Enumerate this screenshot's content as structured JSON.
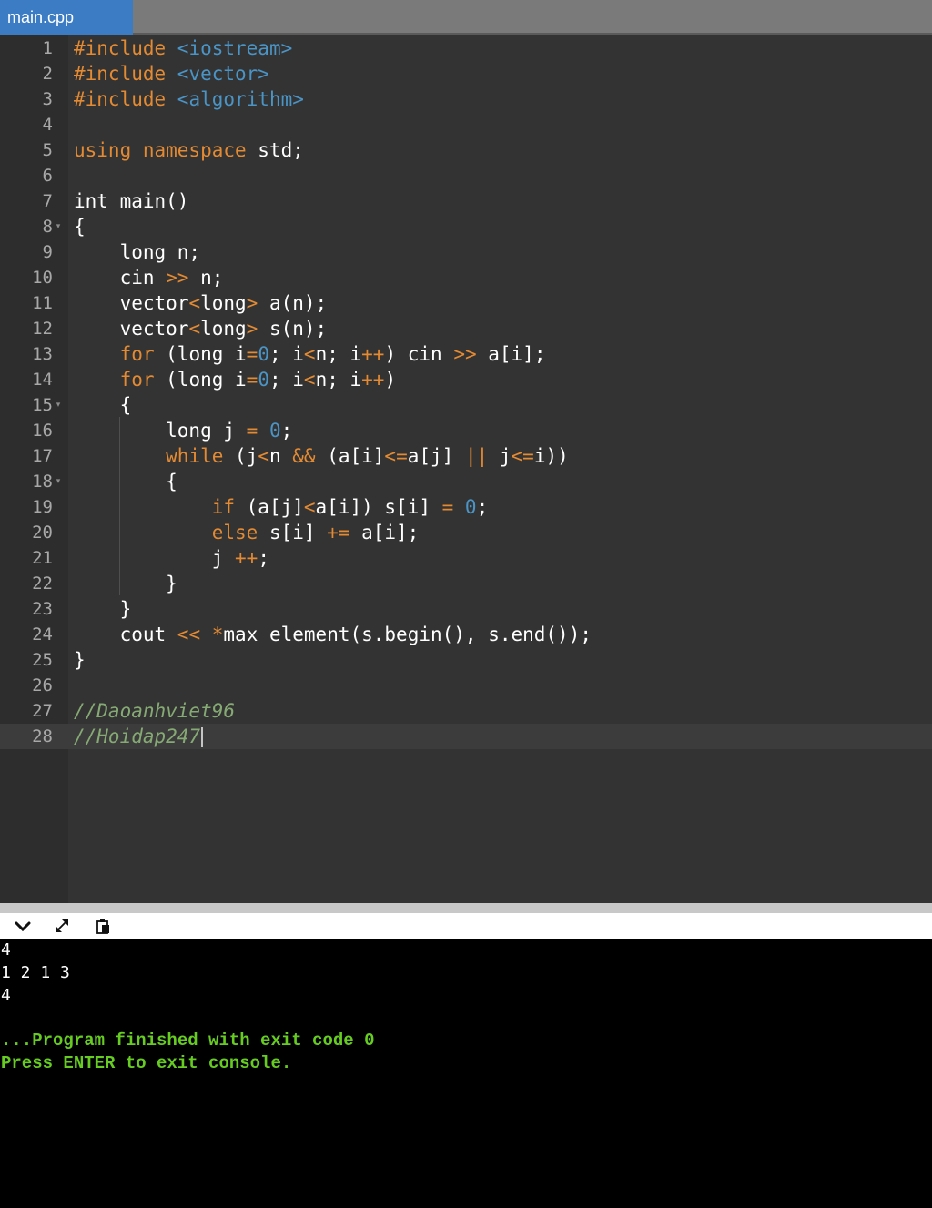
{
  "tab": {
    "label": "main.cpp"
  },
  "editor": {
    "lines": [
      {
        "num": "1",
        "tokens": [
          [
            "pre",
            "#include "
          ],
          [
            "inc",
            "<iostream>"
          ]
        ]
      },
      {
        "num": "2",
        "tokens": [
          [
            "pre",
            "#include "
          ],
          [
            "inc",
            "<vector>"
          ]
        ]
      },
      {
        "num": "3",
        "tokens": [
          [
            "pre",
            "#include "
          ],
          [
            "inc",
            "<algorithm>"
          ]
        ]
      },
      {
        "num": "4",
        "tokens": []
      },
      {
        "num": "5",
        "tokens": [
          [
            "kw",
            "using namespace"
          ],
          [
            "plain",
            " std;"
          ]
        ]
      },
      {
        "num": "6",
        "tokens": []
      },
      {
        "num": "7",
        "tokens": [
          [
            "plain",
            "int main()"
          ]
        ]
      },
      {
        "num": "8",
        "fold": true,
        "tokens": [
          [
            "plain",
            "{"
          ]
        ]
      },
      {
        "num": "9",
        "tokens": [
          [
            "plain",
            "    long n;"
          ]
        ]
      },
      {
        "num": "10",
        "tokens": [
          [
            "plain",
            "    cin "
          ],
          [
            "op",
            ">>"
          ],
          [
            "plain",
            " n;"
          ]
        ]
      },
      {
        "num": "11",
        "tokens": [
          [
            "plain",
            "    vector"
          ],
          [
            "op",
            "<"
          ],
          [
            "plain",
            "long"
          ],
          [
            "op",
            ">"
          ],
          [
            "plain",
            " a(n);"
          ]
        ]
      },
      {
        "num": "12",
        "tokens": [
          [
            "plain",
            "    vector"
          ],
          [
            "op",
            "<"
          ],
          [
            "plain",
            "long"
          ],
          [
            "op",
            ">"
          ],
          [
            "plain",
            " s(n);"
          ]
        ]
      },
      {
        "num": "13",
        "tokens": [
          [
            "plain",
            "    "
          ],
          [
            "kw",
            "for"
          ],
          [
            "plain",
            " (long i"
          ],
          [
            "op",
            "="
          ],
          [
            "num",
            "0"
          ],
          [
            "plain",
            "; i"
          ],
          [
            "op",
            "<"
          ],
          [
            "plain",
            "n; i"
          ],
          [
            "op",
            "++"
          ],
          [
            "plain",
            ") cin "
          ],
          [
            "op",
            ">>"
          ],
          [
            "plain",
            " a[i];"
          ]
        ]
      },
      {
        "num": "14",
        "tokens": [
          [
            "plain",
            "    "
          ],
          [
            "kw",
            "for"
          ],
          [
            "plain",
            " (long i"
          ],
          [
            "op",
            "="
          ],
          [
            "num",
            "0"
          ],
          [
            "plain",
            "; i"
          ],
          [
            "op",
            "<"
          ],
          [
            "plain",
            "n; i"
          ],
          [
            "op",
            "++"
          ],
          [
            "plain",
            ")"
          ]
        ]
      },
      {
        "num": "15",
        "fold": true,
        "tokens": [
          [
            "plain",
            "    {"
          ]
        ]
      },
      {
        "num": "16",
        "tokens": [
          [
            "plain",
            "        long j "
          ],
          [
            "op",
            "="
          ],
          [
            "plain",
            " "
          ],
          [
            "num",
            "0"
          ],
          [
            "plain",
            ";"
          ]
        ]
      },
      {
        "num": "17",
        "tokens": [
          [
            "plain",
            "        "
          ],
          [
            "kw",
            "while"
          ],
          [
            "plain",
            " (j"
          ],
          [
            "op",
            "<"
          ],
          [
            "plain",
            "n "
          ],
          [
            "op",
            "&&"
          ],
          [
            "plain",
            " (a[i]"
          ],
          [
            "op",
            "<="
          ],
          [
            "plain",
            "a[j] "
          ],
          [
            "op",
            "||"
          ],
          [
            "plain",
            " j"
          ],
          [
            "op",
            "<="
          ],
          [
            "plain",
            "i))"
          ]
        ]
      },
      {
        "num": "18",
        "fold": true,
        "tokens": [
          [
            "plain",
            "        {"
          ]
        ]
      },
      {
        "num": "19",
        "tokens": [
          [
            "plain",
            "            "
          ],
          [
            "kw",
            "if"
          ],
          [
            "plain",
            " (a[j]"
          ],
          [
            "op",
            "<"
          ],
          [
            "plain",
            "a[i]) s[i] "
          ],
          [
            "op",
            "="
          ],
          [
            "plain",
            " "
          ],
          [
            "num",
            "0"
          ],
          [
            "plain",
            ";"
          ]
        ]
      },
      {
        "num": "20",
        "tokens": [
          [
            "plain",
            "            "
          ],
          [
            "kw",
            "else"
          ],
          [
            "plain",
            " s[i] "
          ],
          [
            "op",
            "+="
          ],
          [
            "plain",
            " a[i];"
          ]
        ]
      },
      {
        "num": "21",
        "tokens": [
          [
            "plain",
            "            j "
          ],
          [
            "op",
            "++"
          ],
          [
            "plain",
            ";"
          ]
        ]
      },
      {
        "num": "22",
        "tokens": [
          [
            "plain",
            "        }"
          ]
        ]
      },
      {
        "num": "23",
        "tokens": [
          [
            "plain",
            "    }"
          ]
        ]
      },
      {
        "num": "24",
        "tokens": [
          [
            "plain",
            "    cout "
          ],
          [
            "op",
            "<<"
          ],
          [
            "plain",
            " "
          ],
          [
            "op",
            "*"
          ],
          [
            "plain",
            "max_element(s.begin(), s.end());"
          ]
        ]
      },
      {
        "num": "25",
        "tokens": [
          [
            "plain",
            "}"
          ]
        ]
      },
      {
        "num": "26",
        "tokens": []
      },
      {
        "num": "27",
        "tokens": [
          [
            "com",
            "//Daoanhviet96"
          ]
        ]
      },
      {
        "num": "28",
        "active": true,
        "cursor": true,
        "tokens": [
          [
            "com",
            "//Hoidap247"
          ]
        ]
      }
    ]
  },
  "toolbar": {
    "buttons": [
      {
        "name": "collapse-console-button",
        "icon": "chevron-down-icon"
      },
      {
        "name": "expand-console-button",
        "icon": "expand-arrows-icon"
      },
      {
        "name": "copy-output-button",
        "icon": "clipboard-icon"
      }
    ]
  },
  "console": {
    "output": [
      "4",
      "1 2 1 3",
      "4",
      ""
    ],
    "status": [
      "...Program finished with exit code 0",
      "Press ENTER to exit console."
    ]
  },
  "colors": {
    "editor_bg": "#333333",
    "gutter_bg": "#2d2d2d",
    "tab_active": "#3b7cc4",
    "keyword": "#e38a33",
    "number": "#4a94c6",
    "comment": "#86aa74",
    "console_status": "#66cc22"
  }
}
